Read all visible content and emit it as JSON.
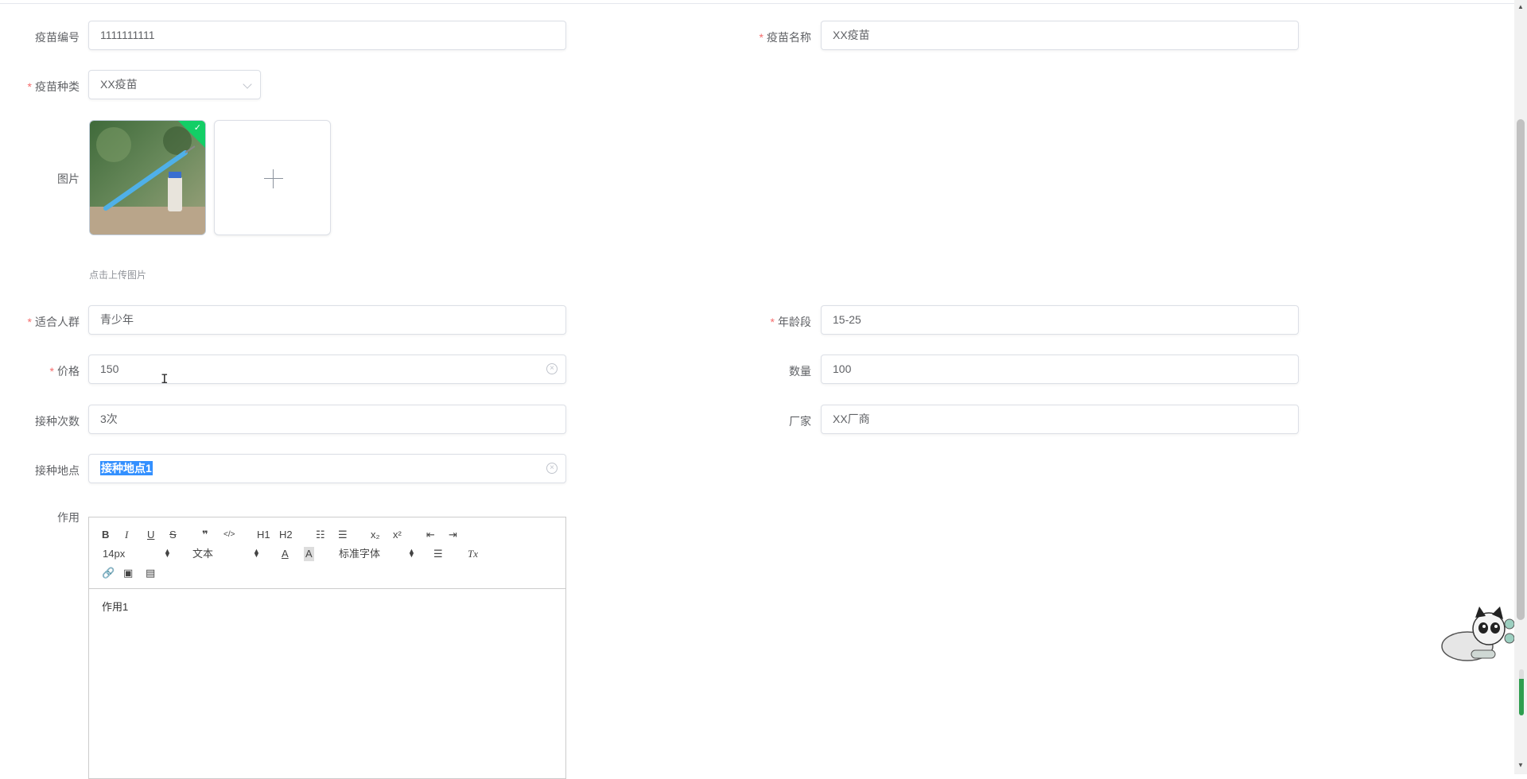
{
  "form": {
    "vaccine_code": {
      "label": "疫苗编号",
      "value": "1111111111",
      "required": false
    },
    "vaccine_name": {
      "label": "疫苗名称",
      "value": "XX疫苗",
      "required": true
    },
    "vaccine_type": {
      "label": "疫苗种类",
      "value": "XX疫苗",
      "required": true
    },
    "image": {
      "label": "图片",
      "tip": "点击上传图片",
      "plus": "+"
    },
    "audience": {
      "label": "适合人群",
      "value": "青少年",
      "required": true
    },
    "age_range": {
      "label": "年龄段",
      "value": "15-25",
      "required": true
    },
    "price": {
      "label": "价格",
      "value": "150",
      "required": true
    },
    "quantity": {
      "label": "数量",
      "value": "100",
      "required": false
    },
    "doses": {
      "label": "接种次数",
      "value": "3次",
      "required": false
    },
    "manufacturer": {
      "label": "厂家",
      "value": "XX厂商",
      "required": false
    },
    "location": {
      "label": "接种地点",
      "value": "接种地点1",
      "required": false
    },
    "effect": {
      "label": "作用",
      "content": "作用1"
    }
  },
  "required_mark": "*",
  "editor_toolbar": {
    "bold": "B",
    "italic": "I",
    "underline": "U",
    "strike": "S",
    "blockquote": "❞",
    "code": "</>",
    "h1": "H1",
    "h2": "H2",
    "ordered_list": "☷",
    "bullet_list": "☰",
    "subscript": "x₂",
    "superscript": "x²",
    "outdent": "⇤",
    "indent": "⇥",
    "size": "14px",
    "block": "文本",
    "font": "标准字体",
    "font_color": "A",
    "background": "A",
    "align": "☰",
    "clean": "Tx",
    "link": "🔗",
    "image": "▣",
    "video": "▤"
  },
  "colors": {
    "accent": "#409EFF",
    "required": "#f56c6c",
    "success": "#13ce66",
    "selection": "#3390ff"
  },
  "scroll_widget": {
    "level": 0.8
  }
}
